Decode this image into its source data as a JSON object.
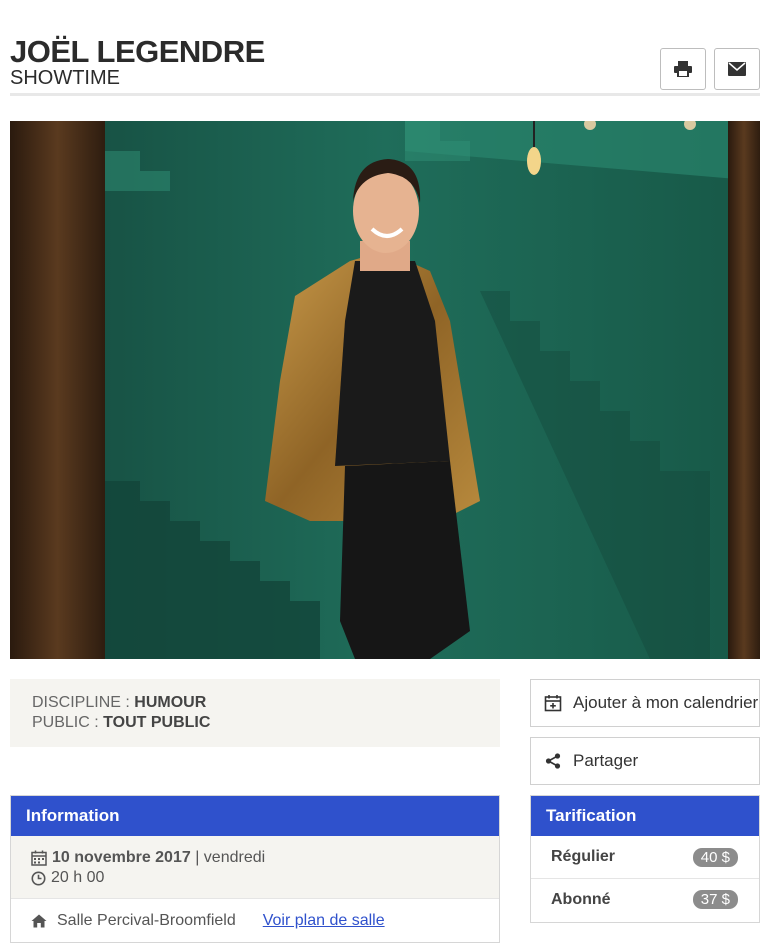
{
  "header": {
    "title": "JOËL LEGENDRE",
    "subtitle": "SHOWTIME",
    "print_icon": "print-icon",
    "mail_icon": "envelope-icon"
  },
  "meta": {
    "discipline_label": "DISCIPLINE :",
    "discipline_value": "HUMOUR",
    "public_label": "PUBLIC :",
    "public_value": "TOUT PUBLIC"
  },
  "actions": {
    "calendar_label": "Ajouter à mon calendrier",
    "calendar_icon": "calendar-plus-icon",
    "share_label": "Partager",
    "share_icon": "share-icon"
  },
  "info": {
    "heading": "Information",
    "date": "10 novembre 2017",
    "separator": " | ",
    "weekday": "vendredi",
    "time": "20 h 00",
    "venue": "Salle Percival-Broomfield",
    "map_link": "Voir plan de salle"
  },
  "pricing": {
    "heading": "Tarification",
    "rows": [
      {
        "label": "Régulier",
        "price": "40 $"
      },
      {
        "label": "Abonné",
        "price": "37 $"
      }
    ]
  },
  "colors": {
    "accent": "#2f51cc",
    "badge": "#8c8c8c",
    "panel_bg": "#f5f4f0"
  }
}
